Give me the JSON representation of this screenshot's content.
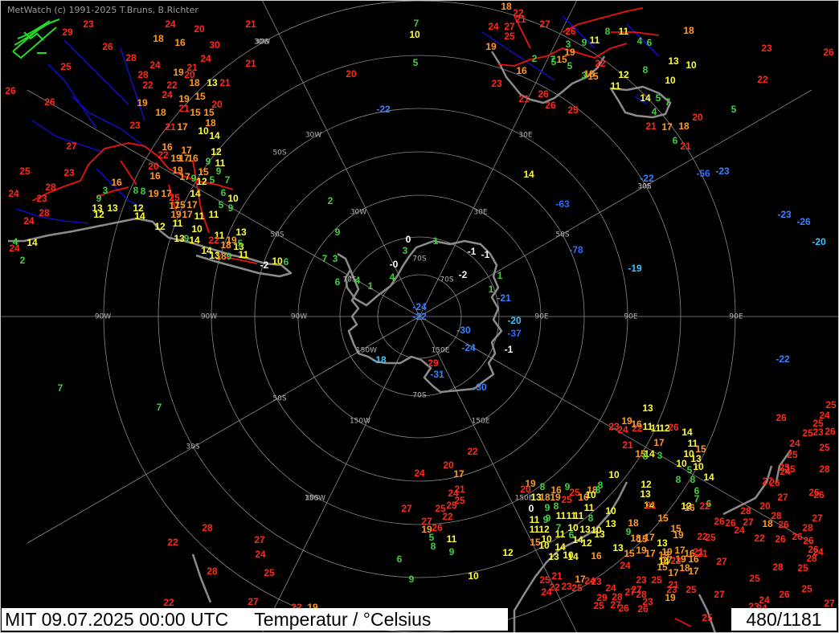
{
  "header": {
    "credit": "MetWatch  (c) 1991-2025 T.Bruns, B.Richter"
  },
  "footer": {
    "timestamp": "MIT 09.07.2025 00:00 UTC",
    "parameter": "Temperatur / °Celsius",
    "counter": "480/1181"
  },
  "colors": {
    "background": "#000000",
    "grid": "#9a9a9a",
    "coast": "#8c8c8c",
    "rivers": "#1010dd",
    "borders": "#ee1111",
    "temp_scale": [
      {
        "min": -100,
        "max": -35,
        "color": "#2d6cff"
      },
      {
        "min": -35,
        "max": -20,
        "color": "#3b82ff"
      },
      {
        "min": -20,
        "max": -10,
        "color": "#39c6ff"
      },
      {
        "min": -10,
        "max": 1,
        "color": "#ffffff"
      },
      {
        "min": 1,
        "max": 10,
        "color": "#3fcf3f"
      },
      {
        "min": 10,
        "max": 15,
        "color": "#ffff33"
      },
      {
        "min": 15,
        "max": 20,
        "color": "#ff9922"
      },
      {
        "min": 20,
        "max": 100,
        "color": "#ff2a1a"
      }
    ]
  },
  "grid_labels": {
    "latitudes": [
      "30S",
      "50S",
      "70S",
      "70S",
      "50S",
      "30S",
      "70S",
      "50S",
      "30S",
      "70S",
      "50S",
      "30S"
    ],
    "longitudes": [
      "30W",
      "30W",
      "30W",
      "30E",
      "30E",
      "30E",
      "90W",
      "90W",
      "90W",
      "90E",
      "90E",
      "90E",
      "150W",
      "150W",
      "150W",
      "150E",
      "150E",
      "150E"
    ]
  },
  "stations": [
    {
      "t": "29"
    },
    {
      "t": "23"
    },
    {
      "t": "24"
    },
    {
      "t": "21"
    },
    {
      "t": "20"
    },
    {
      "t": "16"
    },
    {
      "t": "30"
    },
    {
      "t": "26"
    },
    {
      "t": "28"
    },
    {
      "t": "18"
    },
    {
      "t": "24"
    },
    {
      "t": "21"
    },
    {
      "t": "21"
    },
    {
      "t": "25"
    },
    {
      "t": "26"
    },
    {
      "t": "28"
    },
    {
      "t": "24"
    },
    {
      "t": "20"
    },
    {
      "t": "22"
    },
    {
      "t": "19"
    },
    {
      "t": "13"
    },
    {
      "t": "21"
    },
    {
      "t": "22"
    },
    {
      "t": "24"
    },
    {
      "t": "19"
    },
    {
      "t": "18"
    },
    {
      "t": "15"
    },
    {
      "t": "20"
    },
    {
      "t": "26"
    },
    {
      "t": "19"
    },
    {
      "t": "18"
    },
    {
      "t": "15"
    },
    {
      "t": "21"
    },
    {
      "t": "15"
    },
    {
      "t": "23"
    },
    {
      "t": "18"
    },
    {
      "t": "21"
    },
    {
      "t": "17"
    },
    {
      "t": "10"
    },
    {
      "t": "14"
    },
    {
      "t": "27"
    },
    {
      "t": "16"
    },
    {
      "t": "17"
    },
    {
      "t": "12"
    },
    {
      "t": "25"
    },
    {
      "t": "22"
    },
    {
      "t": "19"
    },
    {
      "t": "17"
    },
    {
      "t": "16"
    },
    {
      "t": "9"
    },
    {
      "t": "11"
    },
    {
      "t": "23"
    },
    {
      "t": "20"
    },
    {
      "t": "19"
    },
    {
      "t": "15"
    },
    {
      "t": "9"
    },
    {
      "t": "9"
    },
    {
      "t": "16"
    },
    {
      "t": "17"
    },
    {
      "t": "12"
    },
    {
      "t": "5"
    },
    {
      "t": "7"
    },
    {
      "t": "28"
    },
    {
      "t": "16"
    },
    {
      "t": "8"
    },
    {
      "t": "19"
    },
    {
      "t": "17"
    },
    {
      "t": "14"
    },
    {
      "t": "6"
    },
    {
      "t": "24"
    },
    {
      "t": "23"
    },
    {
      "t": "3"
    },
    {
      "t": "17"
    },
    {
      "t": "8"
    },
    {
      "t": "25"
    },
    {
      "t": "12"
    },
    {
      "t": "10"
    },
    {
      "t": "9"
    },
    {
      "t": "24"
    },
    {
      "t": "15"
    },
    {
      "t": "17"
    },
    {
      "t": "11"
    },
    {
      "t": "5"
    },
    {
      "t": "9"
    },
    {
      "t": "28"
    },
    {
      "t": "13"
    },
    {
      "t": "13"
    },
    {
      "t": "12"
    },
    {
      "t": "19"
    },
    {
      "t": "17"
    },
    {
      "t": "11"
    },
    {
      "t": "14"
    },
    {
      "t": "12"
    },
    {
      "t": "11"
    },
    {
      "t": "24"
    },
    {
      "t": "9"
    },
    {
      "t": "13"
    },
    {
      "t": "14"
    },
    {
      "t": "11"
    },
    {
      "t": "14"
    },
    {
      "t": "13"
    },
    {
      "t": "10"
    },
    {
      "t": "22"
    },
    {
      "t": "19"
    },
    {
      "t": "18"
    },
    {
      "t": "18"
    },
    {
      "t": "13"
    },
    {
      "t": "13"
    },
    {
      "t": "9"
    },
    {
      "t": "11"
    },
    {
      "t": "-2"
    },
    {
      "t": "10"
    },
    {
      "t": "6"
    },
    {
      "t": "5"
    },
    {
      "t": "9"
    },
    {
      "t": "7"
    },
    {
      "t": "3"
    },
    {
      "t": "6"
    },
    {
      "t": "2"
    },
    {
      "t": "4"
    },
    {
      "t": "1"
    },
    {
      "t": "4"
    },
    {
      "t": "-0"
    },
    {
      "t": "3"
    },
    {
      "t": "0"
    },
    {
      "t": "1"
    },
    {
      "t": "-1"
    },
    {
      "t": "-1"
    },
    {
      "t": "-2"
    },
    {
      "t": "1"
    },
    {
      "t": "1"
    },
    {
      "t": "-21"
    },
    {
      "t": "-24"
    },
    {
      "t": "-22"
    },
    {
      "t": "-30"
    },
    {
      "t": "-20"
    },
    {
      "t": "-37"
    },
    {
      "t": "-24"
    },
    {
      "t": "-1"
    },
    {
      "t": "-18"
    },
    {
      "t": "29"
    },
    {
      "t": "-31"
    },
    {
      "t": "-30"
    },
    {
      "t": "-22"
    },
    {
      "t": "14"
    },
    {
      "t": "-63"
    },
    {
      "t": "-78"
    },
    {
      "t": "-19"
    },
    {
      "t": "-22"
    },
    {
      "t": "-56"
    },
    {
      "t": "-23"
    },
    {
      "t": "-23"
    },
    {
      "t": "-26"
    },
    {
      "t": "-20"
    },
    {
      "t": "-22"
    },
    {
      "t": "7"
    },
    {
      "t": "7"
    },
    {
      "t": "2"
    },
    {
      "t": "4"
    },
    {
      "t": "14"
    },
    {
      "t": "18"
    },
    {
      "t": "21"
    },
    {
      "t": "24"
    },
    {
      "t": "25"
    },
    {
      "t": "27"
    },
    {
      "t": "27"
    },
    {
      "t": "26"
    },
    {
      "t": "22"
    },
    {
      "t": "19"
    },
    {
      "t": "3"
    },
    {
      "t": "9"
    },
    {
      "t": "11"
    },
    {
      "t": "8"
    },
    {
      "t": "11"
    },
    {
      "t": "19"
    },
    {
      "t": "2"
    },
    {
      "t": "7"
    },
    {
      "t": "15"
    },
    {
      "t": "7"
    },
    {
      "t": "5"
    },
    {
      "t": "20"
    },
    {
      "t": "10"
    },
    {
      "t": "13"
    },
    {
      "t": "10"
    },
    {
      "t": "18"
    },
    {
      "t": "11"
    },
    {
      "t": "16"
    },
    {
      "t": "5"
    },
    {
      "t": "5"
    },
    {
      "t": "3"
    },
    {
      "t": "15"
    },
    {
      "t": "18"
    },
    {
      "t": "23"
    },
    {
      "t": "21"
    },
    {
      "t": "26"
    },
    {
      "t": "26"
    },
    {
      "t": "25"
    },
    {
      "t": "22"
    },
    {
      "t": "8"
    },
    {
      "t": "4"
    },
    {
      "t": "12"
    },
    {
      "t": "10"
    },
    {
      "t": "14"
    },
    {
      "t": "4"
    },
    {
      "t": "6"
    },
    {
      "t": "5"
    },
    {
      "t": "7"
    },
    {
      "t": "21"
    },
    {
      "t": "17"
    },
    {
      "t": "20"
    },
    {
      "t": "5"
    },
    {
      "t": "6"
    },
    {
      "t": "21"
    },
    {
      "t": "18"
    },
    {
      "t": "26"
    },
    {
      "t": "23"
    },
    {
      "t": "22"
    },
    {
      "t": "13"
    },
    {
      "t": "19"
    },
    {
      "t": "24"
    },
    {
      "t": "23"
    },
    {
      "t": "22"
    },
    {
      "t": "24"
    },
    {
      "t": "20"
    },
    {
      "t": "17"
    },
    {
      "t": "22"
    },
    {
      "t": "21"
    },
    {
      "t": "24"
    },
    {
      "t": "25"
    },
    {
      "t": "25"
    },
    {
      "t": "25"
    },
    {
      "t": "27"
    },
    {
      "t": "27"
    },
    {
      "t": "26"
    },
    {
      "t": "22"
    },
    {
      "t": "19"
    },
    {
      "t": "5"
    },
    {
      "t": "8"
    },
    {
      "t": "9"
    },
    {
      "t": "6"
    },
    {
      "t": "12"
    },
    {
      "t": "9"
    },
    {
      "t": "10"
    },
    {
      "t": "11"
    },
    {
      "t": "11"
    },
    {
      "t": "11"
    },
    {
      "t": "12"
    },
    {
      "t": "14"
    },
    {
      "t": "11"
    },
    {
      "t": "12"
    },
    {
      "t": "13"
    },
    {
      "t": "14"
    },
    {
      "t": "16"
    },
    {
      "t": "17"
    },
    {
      "t": "21"
    },
    {
      "t": "21"
    },
    {
      "t": "15"
    },
    {
      "t": "14"
    },
    {
      "t": "3"
    },
    {
      "t": "8"
    },
    {
      "t": "10"
    },
    {
      "t": "13"
    },
    {
      "t": "15"
    },
    {
      "t": "10"
    },
    {
      "t": "5"
    },
    {
      "t": "10"
    },
    {
      "t": "14"
    },
    {
      "t": "8"
    },
    {
      "t": "8"
    },
    {
      "t": "6"
    },
    {
      "t": "7"
    },
    {
      "t": "6"
    },
    {
      "t": "12"
    },
    {
      "t": "19"
    },
    {
      "t": "20"
    },
    {
      "t": "8"
    },
    {
      "t": "16"
    },
    {
      "t": "9"
    },
    {
      "t": "25"
    },
    {
      "t": "13"
    },
    {
      "t": "18"
    },
    {
      "t": "19"
    },
    {
      "t": "16"
    },
    {
      "t": "25"
    },
    {
      "t": "18"
    },
    {
      "t": "10"
    },
    {
      "t": "8"
    },
    {
      "t": "10"
    },
    {
      "t": "8"
    },
    {
      "t": "9"
    },
    {
      "t": "0"
    },
    {
      "t": "8"
    },
    {
      "t": "9"
    },
    {
      "t": "11"
    },
    {
      "t": "11"
    },
    {
      "t": "11"
    },
    {
      "t": "11"
    },
    {
      "t": "10"
    },
    {
      "t": "11"
    },
    {
      "t": "9"
    },
    {
      "t": "7"
    },
    {
      "t": "8"
    },
    {
      "t": "10"
    },
    {
      "t": "13"
    },
    {
      "t": "11"
    },
    {
      "t": "12"
    },
    {
      "t": "11"
    },
    {
      "t": "13"
    },
    {
      "t": "6"
    },
    {
      "t": "10"
    },
    {
      "t": "9"
    },
    {
      "t": "10"
    },
    {
      "t": "14"
    },
    {
      "t": "14"
    },
    {
      "t": "10"
    },
    {
      "t": "12"
    },
    {
      "t": "13"
    },
    {
      "t": "15"
    },
    {
      "t": "10"
    },
    {
      "t": "13"
    },
    {
      "t": "14"
    },
    {
      "t": "16"
    },
    {
      "t": "13"
    },
    {
      "t": "15"
    },
    {
      "t": "15"
    },
    {
      "t": "16"
    },
    {
      "t": "15"
    },
    {
      "t": "17"
    },
    {
      "t": "13"
    },
    {
      "t": "17"
    },
    {
      "t": "14"
    },
    {
      "t": "17"
    },
    {
      "t": "15"
    },
    {
      "t": "17"
    },
    {
      "t": "19"
    },
    {
      "t": "16"
    },
    {
      "t": "18"
    },
    {
      "t": "15"
    },
    {
      "t": "19"
    },
    {
      "t": "18"
    },
    {
      "t": "17"
    },
    {
      "t": "19"
    },
    {
      "t": "19"
    },
    {
      "t": "16"
    },
    {
      "t": "18"
    },
    {
      "t": "17"
    },
    {
      "t": "21"
    },
    {
      "t": "21"
    },
    {
      "t": "21"
    },
    {
      "t": "22"
    },
    {
      "t": "22"
    },
    {
      "t": "25"
    },
    {
      "t": "19"
    },
    {
      "t": "22"
    },
    {
      "t": "23"
    },
    {
      "t": "24"
    },
    {
      "t": "27"
    },
    {
      "t": "28"
    },
    {
      "t": "23"
    },
    {
      "t": "19"
    },
    {
      "t": "25"
    },
    {
      "t": "25"
    },
    {
      "t": "24"
    },
    {
      "t": "22"
    },
    {
      "t": "23"
    },
    {
      "t": "21"
    },
    {
      "t": "17"
    },
    {
      "t": "24"
    },
    {
      "t": "25"
    },
    {
      "t": "23"
    },
    {
      "t": "24"
    },
    {
      "t": "25"
    },
    {
      "t": "27"
    },
    {
      "t": "26"
    },
    {
      "t": "29"
    },
    {
      "t": "28"
    },
    {
      "t": "27"
    },
    {
      "t": "26"
    },
    {
      "t": "25"
    },
    {
      "t": "23"
    },
    {
      "t": "26"
    },
    {
      "t": "27"
    },
    {
      "t": "26"
    },
    {
      "t": "27"
    },
    {
      "t": "28"
    },
    {
      "t": "22"
    },
    {
      "t": "20"
    },
    {
      "t": "24"
    },
    {
      "t": "18"
    },
    {
      "t": "26"
    },
    {
      "t": "28"
    },
    {
      "t": "26"
    },
    {
      "t": "28"
    },
    {
      "t": "24"
    },
    {
      "t": "28"
    },
    {
      "t": "26"
    },
    {
      "t": "27"
    },
    {
      "t": "26"
    },
    {
      "t": "25"
    },
    {
      "t": "26"
    },
    {
      "t": "28"
    },
    {
      "t": "26"
    },
    {
      "t": "27"
    },
    {
      "t": "25"
    },
    {
      "t": "26"
    },
    {
      "t": "27"
    },
    {
      "t": "26"
    },
    {
      "t": "25"
    },
    {
      "t": "23"
    },
    {
      "t": "24"
    },
    {
      "t": "25"
    },
    {
      "t": "24"
    },
    {
      "t": "25"
    },
    {
      "t": "25"
    },
    {
      "t": "23"
    },
    {
      "t": "25"
    },
    {
      "t": "26"
    },
    {
      "t": "25"
    },
    {
      "t": "24"
    },
    {
      "t": "26"
    },
    {
      "t": "25"
    },
    {
      "t": "24"
    },
    {
      "t": "26"
    },
    {
      "t": "28"
    },
    {
      "t": "24"
    },
    {
      "t": "27"
    },
    {
      "t": "25"
    },
    {
      "t": "27"
    },
    {
      "t": "23"
    },
    {
      "t": "24"
    },
    {
      "t": "22"
    },
    {
      "t": "22"
    },
    {
      "t": "28"
    },
    {
      "t": "27"
    },
    {
      "t": "24"
    },
    {
      "t": "28"
    },
    {
      "t": "25"
    },
    {
      "t": "27"
    },
    {
      "t": "22"
    },
    {
      "t": "19"
    },
    {
      "t": "22"
    },
    {
      "t": "26"
    },
    {
      "t": "25"
    },
    {
      "t": "21"
    },
    {
      "t": "26"
    },
    {
      "t": "22"
    },
    {
      "t": "19"
    },
    {
      "t": "23"
    },
    {
      "t": "23"
    },
    {
      "t": "24"
    },
    {
      "t": "28"
    },
    {
      "t": "22"
    },
    {
      "t": "11"
    }
  ]
}
